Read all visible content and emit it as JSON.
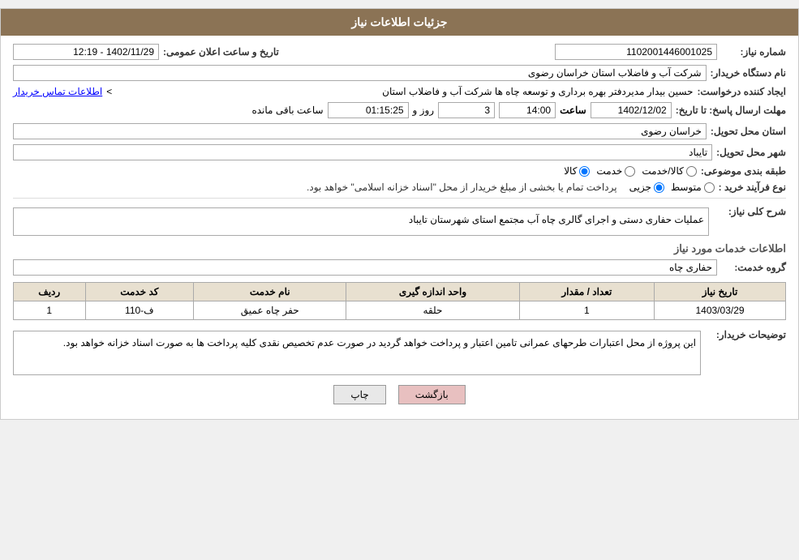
{
  "header": {
    "title": "جزئیات اطلاعات نیاز"
  },
  "fields": {
    "shomara_niaz_label": "شماره نیاز:",
    "shomara_niaz_value": "1102001446001025",
    "name_dastgah_label": "نام دستگاه خریدار:",
    "name_dastgah_value": "شرکت آب و فاضلاب استان خراسان رضوی",
    "tarikh_saaat_label": "تاریخ و ساعت اعلان عمومی:",
    "tarikh_saaat_value": "1402/11/29 - 12:19",
    "ijad_label": "ایجاد کننده درخواست:",
    "ijad_value": "حسین  بیدار مدیردفتر بهره برداری و توسعه چاه ها شرکت آب و فاضلاب استان",
    "ijad_link": "اطلاعات تماس خریدار",
    "mohlat_label": "مهلت ارسال پاسخ: تا تاریخ:",
    "mohlat_date": "1402/12/02",
    "mohlat_saat": "14:00",
    "mohlat_rooz": "3",
    "mohlat_baqi": "01:15:25",
    "baqi_label": "روز و",
    "saaat_baqi_label": "ساعت باقی مانده",
    "ostan_tahvil_label": "استان محل تحویل:",
    "ostan_tahvil_value": "خراسان رضوی",
    "shahr_tahvil_label": "شهر محل تحویل:",
    "shahr_tahvil_value": "تایباد",
    "tabaqe_label": "طبقه بندی موضوعی:",
    "tabaqe_kala": "کالا",
    "tabaqe_khedmat": "خدمت",
    "tabaqe_kala_khedmat": "کالا/خدمت",
    "nooe_farayand_label": "نوع فرآیند خرید :",
    "nooe_jozei": "جزیی",
    "nooe_motavassit": "متوسط",
    "nooe_description": "پرداخت تمام یا بخشی از مبلغ خریدار از محل \"اسناد خزانه اسلامی\" خواهد بود.",
    "sharh_label": "شرح کلی نیاز:",
    "sharh_value": "عملیات حفاری دستی و اجرای گالری چاه آب مجتمع استای شهرستان تایباد",
    "section_title": "اطلاعات خدمات مورد نیاز",
    "gorooh_label": "گروه خدمت:",
    "gorooh_value": "حفاری چاه",
    "table_headers": {
      "radif": "ردیف",
      "code": "کد خدمت",
      "name": "نام خدمت",
      "unit": "واحد اندازه گیری",
      "count": "تعداد / مقدار",
      "date": "تاریخ نیاز"
    },
    "table_rows": [
      {
        "radif": "1",
        "code": "ف-110",
        "name": "حفر چاه عمیق",
        "unit": "حلقه",
        "count": "1",
        "date": "1403/03/29"
      }
    ],
    "tosihaat_label": "توضیحات خریدار:",
    "tosihaat_value": "این پروژه از محل اعتبارات طرحهای عمرانی تامین اعتبار و پرداخت خواهد گردید در صورت عدم تخصیص نقدی کلیه پرداخت ها به صورت اسناد خزانه خواهد بود.",
    "btn_back": "بازگشت",
    "btn_print": "چاپ"
  }
}
